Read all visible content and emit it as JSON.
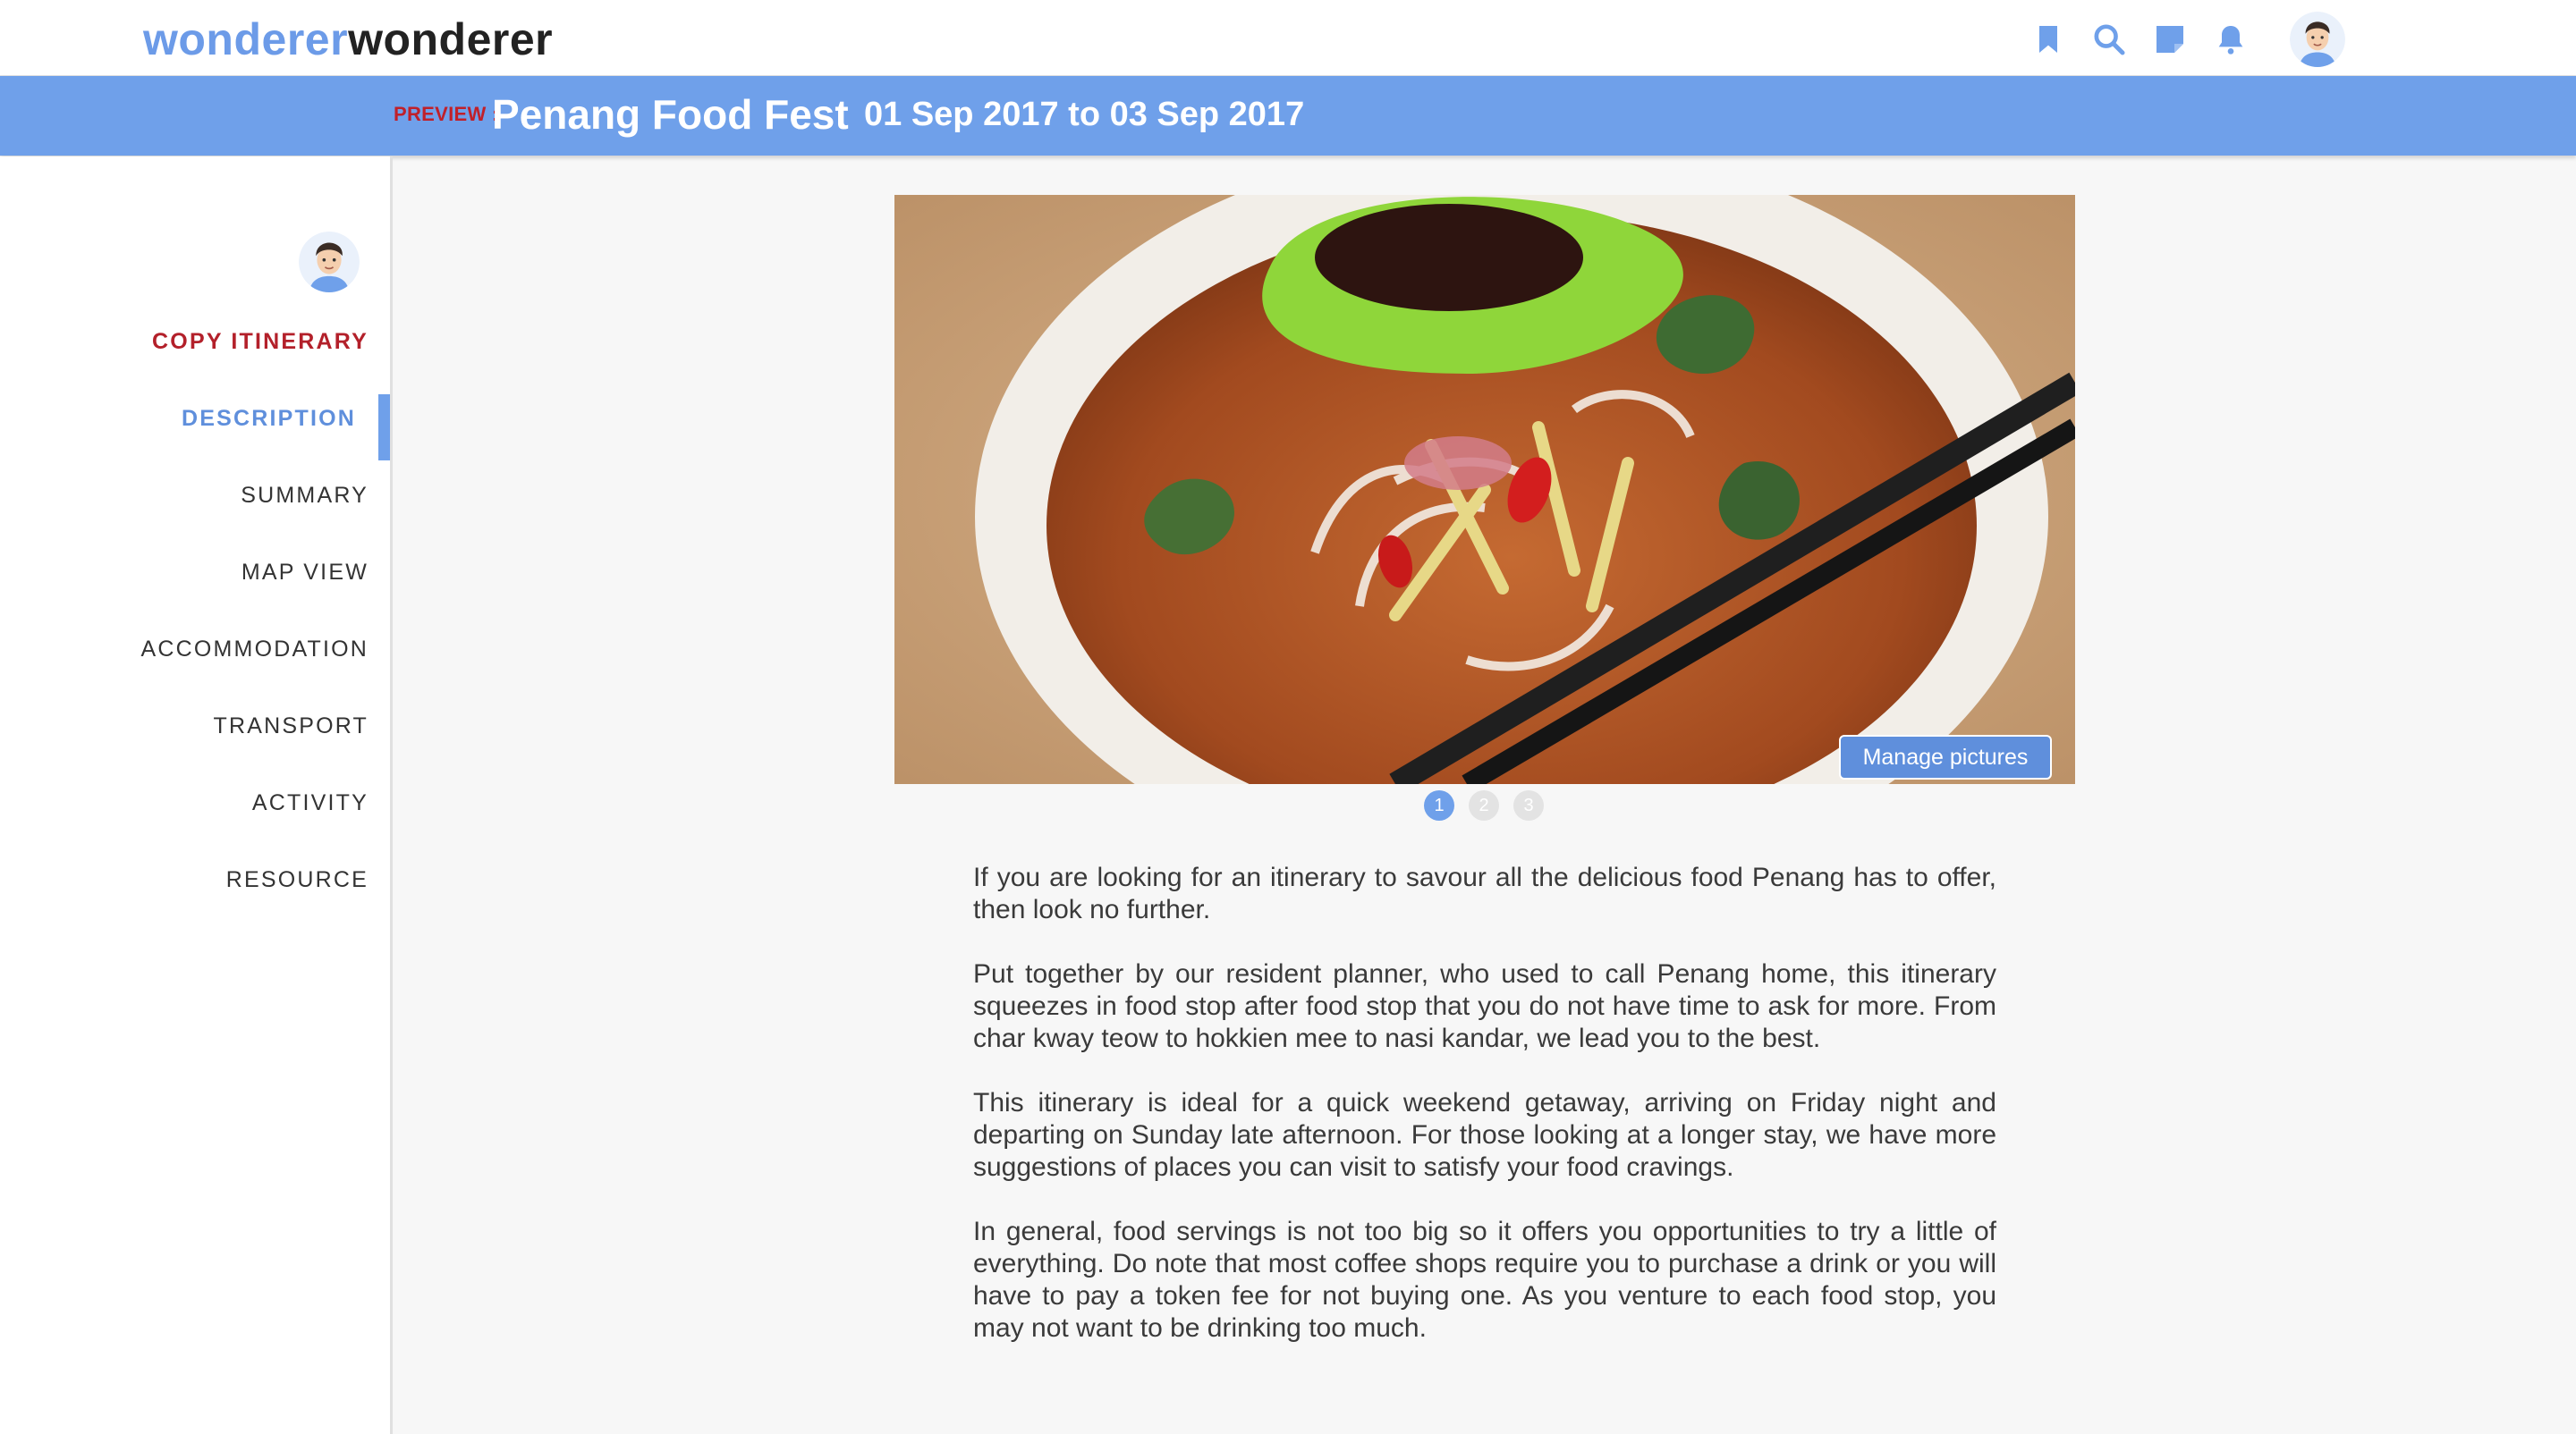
{
  "app": {
    "logo_part_a": "wonderer",
    "logo_part_b": "wonderer"
  },
  "topbar": {
    "icons": [
      "bookmark-icon",
      "search-icon",
      "note-icon",
      "bell-icon"
    ]
  },
  "header": {
    "preview_label": "PREVIEW :",
    "title": "Penang Food Fest",
    "dates": "01 Sep 2017 to 03 Sep 2017"
  },
  "sidebar": {
    "items": [
      {
        "label": "COPY ITINERARY"
      },
      {
        "label": "DESCRIPTION"
      },
      {
        "label": "SUMMARY"
      },
      {
        "label": "MAP VIEW"
      },
      {
        "label": "ACCOMMODATION"
      },
      {
        "label": "TRANSPORT"
      },
      {
        "label": "ACTIVITY"
      },
      {
        "label": "RESOURCE"
      }
    ],
    "active_index": 1
  },
  "gallery": {
    "manage_label": "Manage pictures",
    "pages": [
      "1",
      "2",
      "3"
    ],
    "current_page": 1
  },
  "description": {
    "paragraphs": [
      "If you are looking for an itinerary to savour all the delicious food Penang has to offer, then look no further.",
      "Put together by our resident planner, who used to call Penang home, this itinerary squeezes in food stop after food stop that you do not have time to ask for more. From char kway teow to hokkien mee to nasi kandar, we lead you to the best.",
      "This itinerary is ideal for a quick weekend getaway, arriving on Friday night and departing on Sunday late afternoon. For those looking at a longer stay, we have more suggestions of places you can visit to satisfy your food cravings.",
      "In general, food servings is not too big so it offers you opportunities to try a little of everything. Do note that most coffee shops require you to purchase a drink or you will have to pay a token fee for not buying one. As you venture to each food stop, you may not want to be drinking too much."
    ]
  },
  "colors": {
    "accent": "#6fa0ea",
    "copy_red": "#b3202a",
    "active_text": "#5f8fdc"
  }
}
